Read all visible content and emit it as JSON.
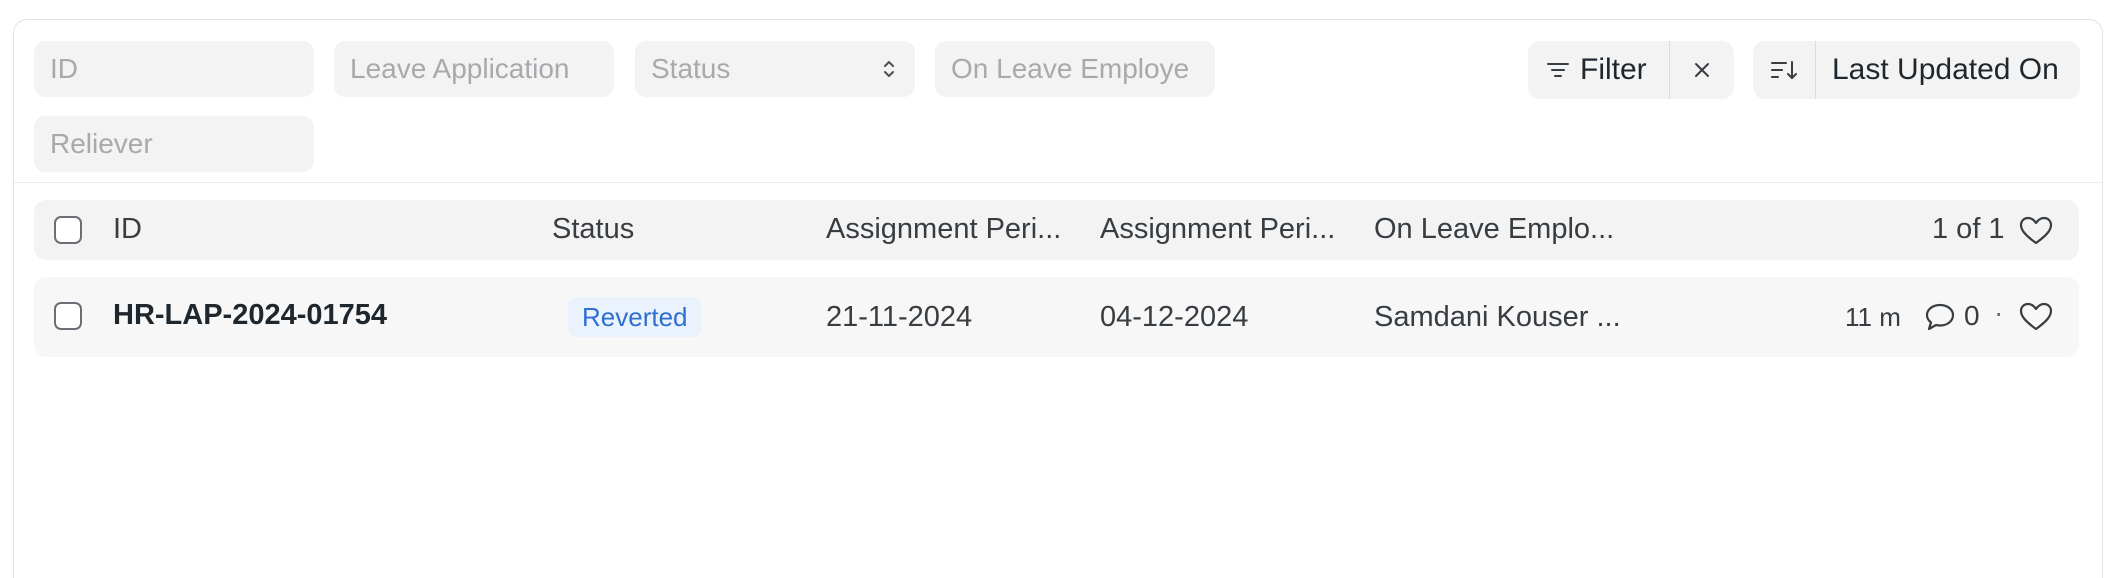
{
  "filters": {
    "id_placeholder": "ID",
    "leave_application_placeholder": "Leave Application",
    "status_placeholder": "Status",
    "on_leave_employee_placeholder": "On Leave Employe",
    "reliever_placeholder": "Reliever"
  },
  "toolbar": {
    "filter_label": "Filter",
    "sort_label": "Last Updated On"
  },
  "list": {
    "columns": {
      "id": "ID",
      "status": "Status",
      "assignment_period_1": "Assignment Peri...",
      "assignment_period_2": "Assignment Peri...",
      "on_leave_employee": "On Leave Emplo..."
    },
    "count_label": "1 of 1",
    "rows": [
      {
        "id": "HR-LAP-2024-01754",
        "status": "Reverted",
        "assignment_period_from": "21-11-2024",
        "assignment_period_to": "04-12-2024",
        "on_leave_employee": "Samdani Kouser ...",
        "modified": "11 m",
        "comment_count": "0",
        "dot": "·"
      }
    ]
  },
  "icons": {
    "filter": "filter-lines-icon",
    "clear": "close-icon",
    "sort": "sort-descending-icon",
    "like": "heart-icon",
    "comment": "comment-bubble-icon",
    "select": "chevron-up-down-icon"
  },
  "colors": {
    "status_badge_bg": "#eaf2fd",
    "status_badge_text": "#2f6fd1",
    "field_bg": "#f3f3f3"
  }
}
